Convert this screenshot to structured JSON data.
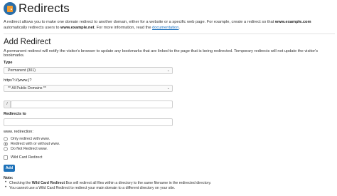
{
  "page": {
    "title": "Redirects",
    "logo_icon": "cpanel-redirect-icon",
    "intro_part1": "A redirect allows you to make one domain redirect to another domain, either for a website or a specific web page. For example, create a redirect so that ",
    "intro_bold1": "www.example.com",
    "intro_part2": " automatically redirects users to ",
    "intro_bold2": "www.example.net",
    "intro_part3": ". For more information, read the ",
    "intro_link": "documentation",
    "intro_end": "."
  },
  "form": {
    "heading": "Add Redirect",
    "description": "A permanent redirect will notify the visitor's browser to update any bookmarks that are linked to the page that is being redirected. Temporary redirects will not update the visitor's bookmarks.",
    "type_label": "Type",
    "type_value": "Permanent (301)",
    "domain_label": "https?://(www.)?",
    "domain_value": "** All Public Domains **",
    "path_prefix": "/",
    "path_value": "",
    "redirects_to_label": "Redirects to",
    "redirects_to_value": "",
    "www_label": "www. redirection:",
    "www_options": [
      {
        "label": "Only redirect with www.",
        "checked": false
      },
      {
        "label": "Redirect with or without www.",
        "checked": true
      },
      {
        "label": "Do Not Redirect www.",
        "checked": false
      }
    ],
    "wildcard_label": "Wild Card Redirect",
    "add_button": "Add"
  },
  "note": {
    "title": "Note:",
    "line1_pre": "Checking the ",
    "line1_bold": "Wild Card Redirect",
    "line1_post": " Box will redirect all files within a directory to the same filename in the redirected directory.",
    "line2": "You cannot use a Wild Card Redirect to redirect your main domain to a different directory on your site."
  },
  "colors": {
    "accent": "#1e72b9",
    "link": "#1a6fbd"
  }
}
